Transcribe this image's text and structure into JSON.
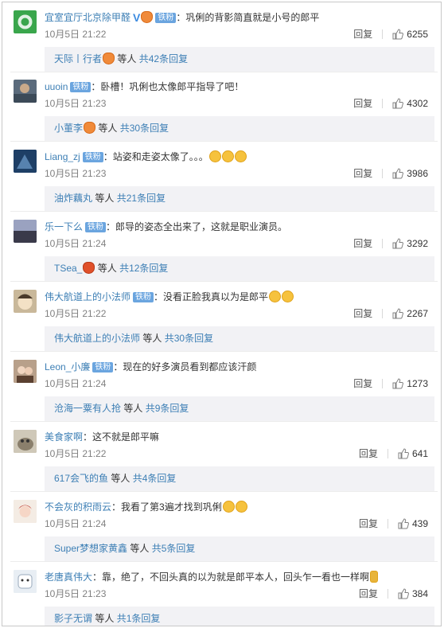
{
  "common": {
    "reply_label": "回复",
    "badge_label": "铁粉",
    "thumb_icon": "thumb-up-icon"
  },
  "comments": [
    {
      "username": "宜室宜厅北京除甲醛",
      "verified": true,
      "badge": "铁粉",
      "text": "巩俐的背影简直就是小号的郎平",
      "time": "10月5日 21:22",
      "likes": "6255",
      "reply_names": "天际丨行者",
      "reply_tail": "等人",
      "reply_count": "共42条回复",
      "avatar_color": "#3aa64c"
    },
    {
      "username": "uuoin",
      "badge": "铁粉",
      "text": "卧槽！巩俐也太像郎平指导了吧！",
      "time": "10月5日 21:23",
      "likes": "4302",
      "reply_names": "小董李",
      "reply_tail": "等人",
      "reply_count": "共30条回复",
      "avatar_color": "#5b6b7c"
    },
    {
      "username": "Liang_zj",
      "badge": "铁粉",
      "text": "站姿和走姿太像了。。。",
      "time": "10月5日 21:23",
      "likes": "3986",
      "reply_names": "油炸藕丸",
      "reply_tail": "等人",
      "reply_count": "共21条回复",
      "avatar_color": "#2f5d8a"
    },
    {
      "username": "乐一下么",
      "badge": "铁粉",
      "text": "郎导的姿态全出来了，这就是职业演员。",
      "time": "10月5日 21:24",
      "likes": "3292",
      "reply_names": "TSea_",
      "reply_tail": "等人",
      "reply_count": "共12条回复",
      "avatar_color": "#7a7f96"
    },
    {
      "username": "伟大航道上的小法师",
      "badge": "铁粉",
      "text": "没看正脸我真以为是郎平",
      "time": "10月5日 21:22",
      "likes": "2267",
      "reply_names": "伟大航道上的小法师",
      "reply_tail": "等人",
      "reply_count": "共30条回复",
      "avatar_color": "#c9b89a"
    },
    {
      "username": "Leon_小廉",
      "badge": "铁粉",
      "text": "现在的好多演员看到都应该汗颜",
      "time": "10月5日 21:24",
      "likes": "1273",
      "reply_names": "沧海一粟有人抢",
      "reply_tail": "等人",
      "reply_count": "共9条回复",
      "avatar_color": "#8a6a55"
    },
    {
      "username": "美食家啊",
      "text": "这不就是郎平嘛",
      "time": "10月5日 21:22",
      "likes": "641",
      "reply_names": "617会飞的鱼",
      "reply_tail": "等人",
      "reply_count": "共4条回复",
      "avatar_color": "#a7a08f"
    },
    {
      "username": "不会灰的积雨云",
      "text": "我看了第3遍才找到巩俐",
      "time": "10月5日 21:24",
      "likes": "439",
      "reply_names": "Super梦想家黄鑫",
      "reply_tail": "等人",
      "reply_count": "共5条回复",
      "avatar_color": "#e8d8c8"
    },
    {
      "username": "老唐真伟大",
      "text": "：靠，绝了，不回头真的以为就是郎平本人，回头乍一看也一样啊",
      "time": "10月5日 21:23",
      "likes": "384",
      "reply_names": "影子无谓",
      "reply_tail": "等人",
      "reply_count": "共1条回复",
      "avatar_color": "#d8e0e8"
    }
  ]
}
